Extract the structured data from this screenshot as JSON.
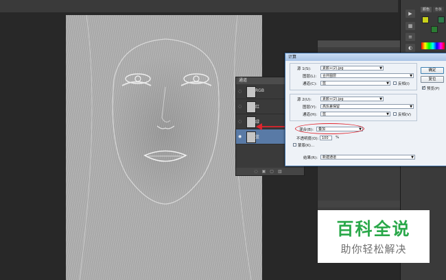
{
  "channels_panel": {
    "title": "通道",
    "items": [
      {
        "label": "RGB",
        "selected": false
      },
      {
        "label": "红",
        "selected": false
      },
      {
        "label": "绿",
        "selected": false
      },
      {
        "label": "蓝",
        "selected": true
      }
    ]
  },
  "dialog": {
    "title": "计算",
    "source1": {
      "label": "源 1(S):",
      "value": "素颜+(2).jpg",
      "layer_label": "图层(L):",
      "layer_value": "合并图层",
      "channel_label": "通道(C):",
      "channel_value": "蓝",
      "invert_label": "反相(I)"
    },
    "source2": {
      "label": "源 2(U):",
      "value": "素颜+(2).jpg",
      "layer_label": "图层(Y):",
      "layer_value": "高反差保留",
      "channel_label": "通道(H):",
      "channel_value": "蓝",
      "invert_label": "反相(V)"
    },
    "blending": {
      "label": "混合(B):",
      "value": "叠加",
      "opacity_label": "不透明度(O):",
      "opacity_value": "100",
      "opacity_unit": "%",
      "mask_label": "蒙版(K)..."
    },
    "result": {
      "label": "结果(R):",
      "value": "新建通道"
    },
    "buttons": {
      "ok": "确定",
      "reset": "复位",
      "preview": "预览(P)"
    }
  },
  "right_panel": {
    "tab1": "颜色",
    "tab2": "色板"
  },
  "watermark": {
    "title": "百科全说",
    "subtitle": "助你轻松解决"
  },
  "colors": {
    "annotation": "#e0242d",
    "watermark_green": "#2aa84a",
    "selected_channel": "#597aa6"
  }
}
